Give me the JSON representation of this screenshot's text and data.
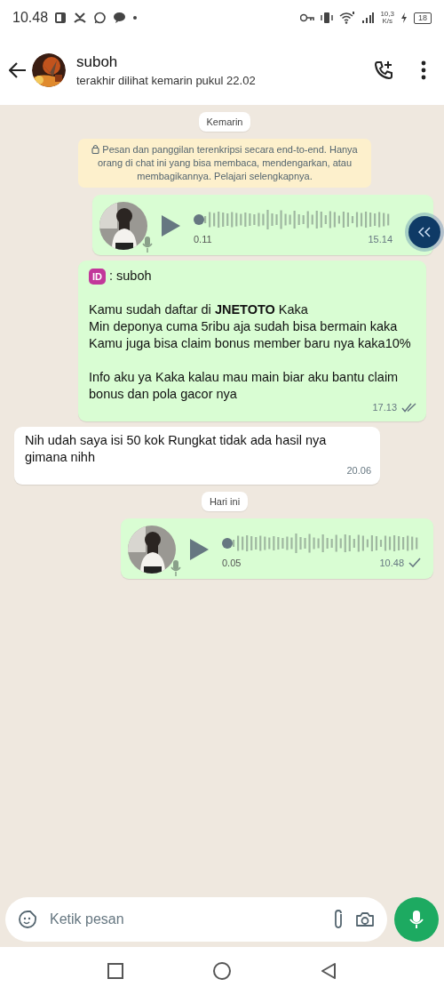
{
  "status_bar": {
    "time": "10.48",
    "net_speed": "10,3",
    "net_unit": "K/s",
    "battery": "18"
  },
  "header": {
    "name": "suboh",
    "subtitle": "terakhir dilihat kemarin pukul 22.02"
  },
  "messages": [
    {
      "kind": "date",
      "text": "Kemarin"
    },
    {
      "kind": "notice",
      "text": "Pesan dan panggilan terenkripsi secara end-to-end. Hanya orang di chat ini yang bisa membaca, mendengarkan, atau membagikannya. Pelajari selengkapnya."
    },
    {
      "kind": "voice",
      "outgoing": true,
      "level": 0,
      "duration": "0.11",
      "time": "15.14"
    },
    {
      "kind": "text",
      "outgoing": true,
      "badge": "ID",
      "sender": ": suboh",
      "body": "Kamu sudah daftar di **JNETOTO** Kaka\nMin deponya cuma 5ribu aja sudah bisa bermain kaka\nKamu juga bisa claim bonus member baru nya kaka10%\n\nInfo aku ya Kaka kalau mau main biar aku bantu claim bonus dan pola gacor nya",
      "time": "17.13",
      "read": true
    },
    {
      "kind": "text",
      "outgoing": false,
      "body": "Nih udah saya isi 50 kok Rungkat tidak ada hasil nya gimana nihh",
      "time": "20.06"
    },
    {
      "kind": "date",
      "text": "Hari ini"
    },
    {
      "kind": "voice",
      "outgoing": true,
      "level": 0,
      "duration": "0.05",
      "time": "10.48",
      "read": false
    }
  ],
  "composer": {
    "placeholder": "Ketik pesan"
  }
}
